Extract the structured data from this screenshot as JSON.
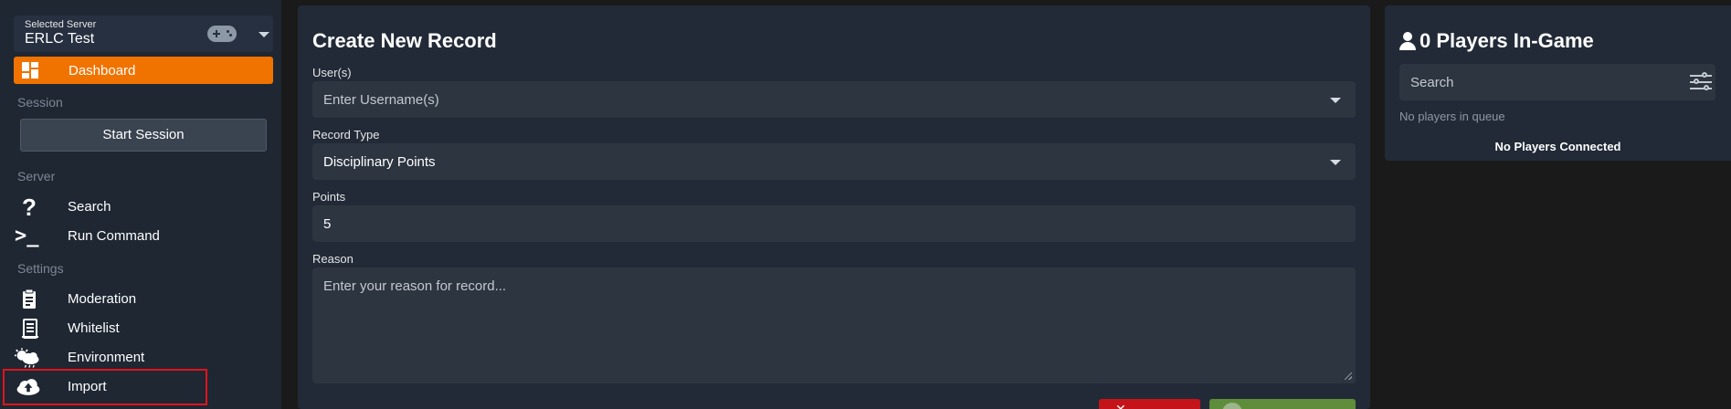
{
  "sidebar": {
    "server": {
      "caption": "Selected Server",
      "name": "ERLC Test"
    },
    "dashboard_label": "Dashboard",
    "sections": {
      "session": "Session",
      "server": "Server",
      "settings": "Settings"
    },
    "start_session_label": "Start Session",
    "server_items": [
      {
        "label": "Search",
        "icon": "question-icon"
      },
      {
        "label": "Run Command",
        "icon": "terminal-icon"
      }
    ],
    "settings_items": [
      {
        "label": "Moderation",
        "icon": "clipboard-icon"
      },
      {
        "label": "Whitelist",
        "icon": "list-document-icon"
      },
      {
        "label": "Environment",
        "icon": "weather-icon"
      },
      {
        "label": "Import",
        "icon": "cloud-upload-icon"
      }
    ]
  },
  "record_form": {
    "title": "Create New Record",
    "users": {
      "label": "User(s)",
      "placeholder": "Enter Username(s)"
    },
    "record_type": {
      "label": "Record Type",
      "value": "Disciplinary Points"
    },
    "points": {
      "label": "Points",
      "value": "5"
    },
    "reason": {
      "label": "Reason",
      "placeholder": "Enter your reason for record..."
    }
  },
  "players_panel": {
    "title": "0 Players In-Game",
    "search_placeholder": "Search",
    "queue_text": "No players in queue",
    "connected_text": "No Players Connected"
  },
  "colors": {
    "accent": "#f07300",
    "cancel": "#c4141a",
    "submit": "#5e8d3b",
    "highlight": "#e0141b"
  }
}
